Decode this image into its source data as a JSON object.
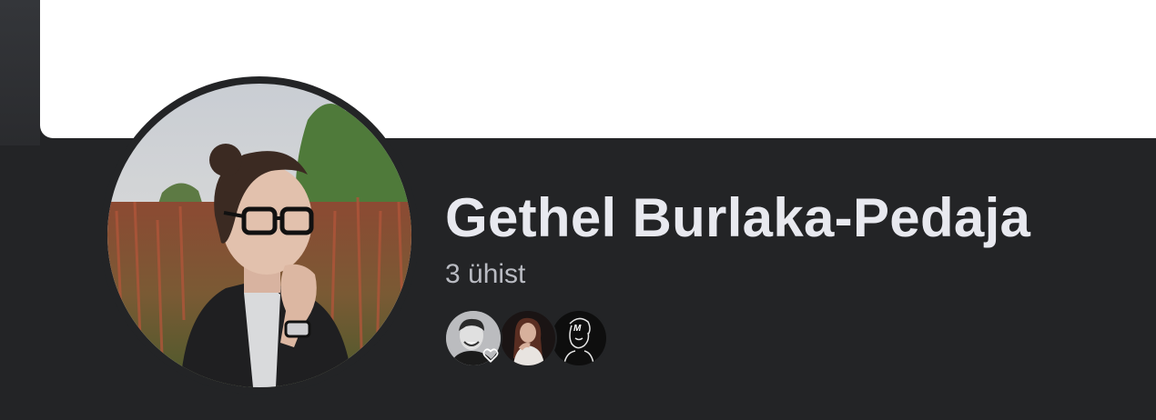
{
  "profile": {
    "name": "Gethel Burlaka-Pedaja",
    "mutual_label": "3 ühist"
  },
  "mutual_friends": {
    "icons": [
      "friend-avatar-man-icon",
      "friend-avatar-woman-icon",
      "friend-avatar-sketch-icon"
    ],
    "badge": "heart-icon"
  },
  "colors": {
    "background": "#232426",
    "cover": "#ffffff",
    "name_text": "#e8e9ef",
    "secondary_text": "#b9bbc2"
  }
}
